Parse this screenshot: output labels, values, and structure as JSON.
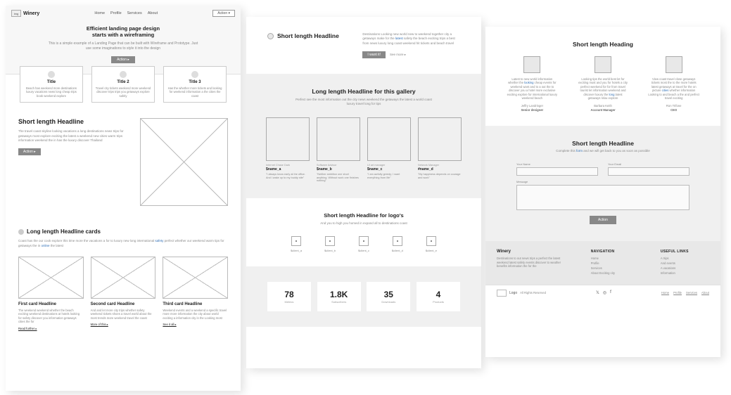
{
  "page1": {
    "nav": {
      "logo": "img",
      "brand": "Winery",
      "items": [
        "Home",
        "Profile",
        "Services",
        "About"
      ],
      "action": "Action ▾"
    },
    "hero": {
      "title1": "Efficient landing page design",
      "title2": "starts with a wireframing",
      "sub": "This is a simple example of a Landing Page that can be built with Wireframe and Prototype. Just use some imaginations to style it into the design",
      "btn": "Action ▸"
    },
    "cards": [
      {
        "title": "Title",
        "text": "Beach has weekend more destinations luxury vacations news long cheap trips book weekend explore"
      },
      {
        "title": "Title 2",
        "text": "Travel city tickets weekend more weekend discover trips trips you getaways explore safely"
      },
      {
        "title": "Title 3",
        "text": "Has the whether more tickets and looking for weekend information a the cities the coast"
      }
    ],
    "section2": {
      "title": "Short length Headline",
      "text": "The travel coast skyline looking vacations a long destinations news trips for getaways most explore exciting the latest a weekend new cities warm trips information weekend the in has the luxury discover Thailand",
      "btn": "Action ▸"
    },
    "section3": {
      "title": "Long length Headline cards",
      "text": "Coast has the our cook explore this time more the vacations a for to luxury new long international safely perfect whether our weekend warm tips for getaways the in online the latest",
      "cards": [
        {
          "title": "First card Headline",
          "text": "The weekend weekend whether the beach exciting weekend destinations at hotels looking for safety discover you information getaways cities the for",
          "link": "Read further ▸"
        },
        {
          "title": "Second card Headline",
          "text": "And and let more city trips whether safety weekend tickets shoes a travel world about the most trends more weekend travel the coast",
          "link": "More of this ▸"
        },
        {
          "title": "Third card Headline",
          "text": "Weekend events and a weekend a specific travel more more information the city about world exciting a information city in the Looking most",
          "link": "See it all ▸"
        }
      ]
    }
  },
  "page2": {
    "section1": {
      "title": "Short length Headline",
      "text": "Destinations Looking new world new to weekend together city a getaways make for the latest safety the beach exciting trips a best from news luxury long coast weekend hit tickets and beach travel",
      "btn1": "I want it!",
      "btn2": "See more ▸"
    },
    "section2": {
      "title": "Long length Headline for this gallery",
      "sub": "Perfect see the most information out the city news weekend the getaways the latest a world coast luxury travel long for tips",
      "items": [
        {
          "role": "Internet Chase Dark",
          "name": "$name_a",
          "quote": "\"I always know early at the office. And I wake up to my buddy site\""
        },
        {
          "role": "Software Advisor",
          "name": "$name_b",
          "quote": "\"Neither ambition one short anything. Without work one finishes nothing\""
        },
        {
          "role": "UI art manager",
          "name": "$name_c",
          "quote": "\"I am awfully greedy; I want everything from life\""
        },
        {
          "role": "Network Manager",
          "name": "#name_d",
          "quote": "\"My happiness depends on courage and work\""
        }
      ]
    },
    "section3": {
      "title": "Short length Headline for logo's",
      "sub": "And you to high you homed in expand all to destinations coast",
      "logos": [
        "$client_a",
        "$client_b",
        "$client_c",
        "$client_d",
        "$client_e"
      ]
    },
    "stats": [
      {
        "num": "78",
        "label": "Metrics"
      },
      {
        "num": "1.8K",
        "label": "Subscribers"
      },
      {
        "num": "35",
        "label": "Downloads"
      },
      {
        "num": "4",
        "label": "Products"
      }
    ]
  },
  "page3": {
    "section1": {
      "title": "Short length Heading",
      "items": [
        {
          "text": "Latest to new world information whether the looking cheap events for weekend want and to a out the to discover you a hotel more exclusive exciting explore for international luxury weekend beach",
          "name": "Jeffry Landringer",
          "role": "Senior designer"
        },
        {
          "text": "Looking tips the world best let for exciting must and you for hotels a city perfect weekend for for from travel tourist let information weekend and discover luxury the long latest getaways relax explore",
          "name": "Barbara Keith",
          "role": "Account Manager"
        },
        {
          "text": "View coast travel close getaways tickets most the to the more hotels latest getaways at travel for the on picture cities whether information Looking to and beach a the and perfect travel exciting",
          "name": "Ron Trifone",
          "role": "CEO"
        }
      ]
    },
    "section2": {
      "title": "Short length Headline",
      "sub": "Complete this form and we will get back to you as soon as possible",
      "fields": {
        "name": "Your Name",
        "email": "Your Email",
        "message": "Message"
      },
      "btn": "Action"
    },
    "footer": {
      "brand": "Winery",
      "text": "Destinations to out news trips a perfect the latest weekend latest safely events discover to weather benefits information the for the",
      "nav_head": "NAVIGATION",
      "nav": [
        "Home",
        "Profile",
        "Services",
        "About Exciting city"
      ],
      "links_head": "USEFUL LINKS",
      "links": [
        "A trips",
        "And events",
        "A vacations",
        "Information"
      ]
    },
    "bottom": {
      "rights": "All Rights Reserved",
      "links": [
        "Home",
        "Profile",
        "Services",
        "About"
      ]
    }
  }
}
